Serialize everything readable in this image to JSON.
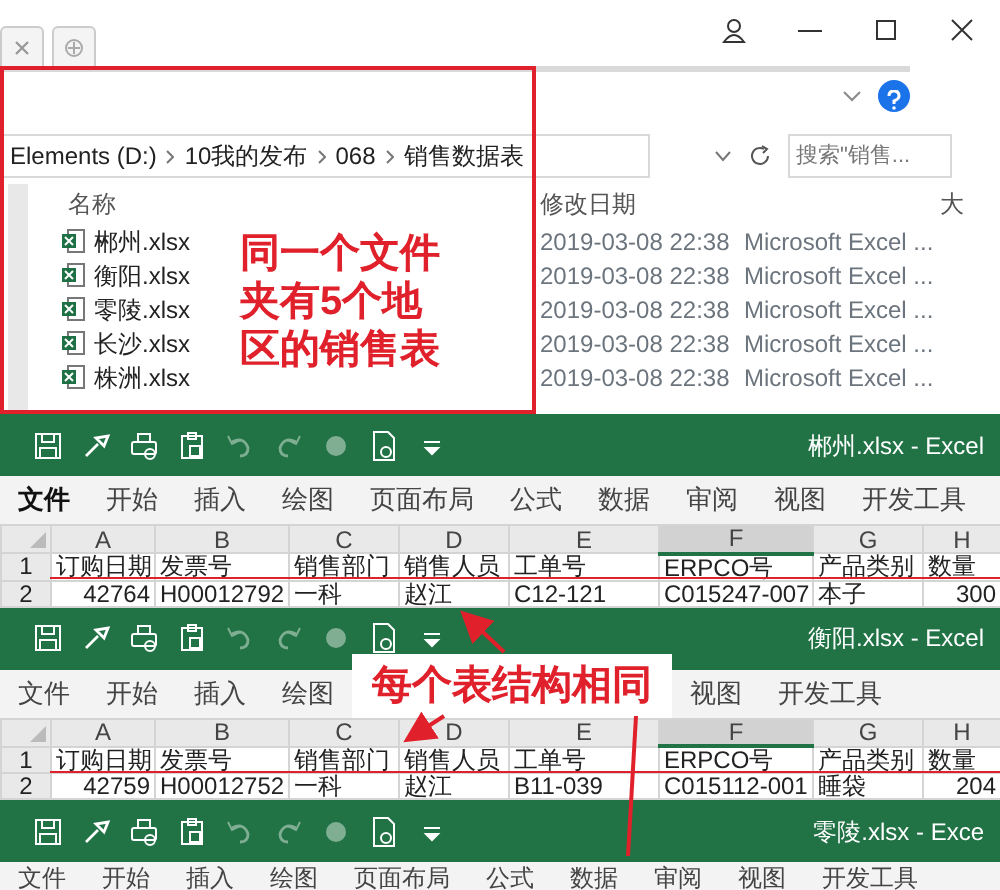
{
  "explorer": {
    "breadcrumbs": [
      "Elements (D:)",
      "10我的发布",
      "068",
      "销售数据表"
    ],
    "search": {
      "placeholder": "搜索\"销售..."
    },
    "columns": [
      "名称",
      "修改日期",
      "大"
    ],
    "files": [
      {
        "name": "郴州.xlsx",
        "modified": "2019-03-08 22:38",
        "type": "Microsoft Excel ..."
      },
      {
        "name": "衡阳.xlsx",
        "modified": "2019-03-08 22:38",
        "type": "Microsoft Excel ..."
      },
      {
        "name": "零陵.xlsx",
        "modified": "2019-03-08 22:38",
        "type": "Microsoft Excel ..."
      },
      {
        "name": "长沙.xlsx",
        "modified": "2019-03-08 22:38",
        "type": "Microsoft Excel ..."
      },
      {
        "name": "株洲.xlsx",
        "modified": "2019-03-08 22:38",
        "type": "Microsoft Excel ..."
      }
    ],
    "note": "同一个文件夹有5个地区的销售表"
  },
  "quick_access": [
    {
      "kind": "save",
      "disabled": false
    },
    {
      "kind": "brush",
      "disabled": false
    },
    {
      "kind": "print",
      "disabled": false
    },
    {
      "kind": "clipboard",
      "disabled": false
    },
    {
      "kind": "undo",
      "disabled": true
    },
    {
      "kind": "redo",
      "disabled": true
    },
    {
      "kind": "circle",
      "disabled": true
    },
    {
      "kind": "document",
      "disabled": false
    },
    {
      "kind": "more",
      "disabled": false
    }
  ],
  "workbooks": [
    {
      "title": "郴州.xlsx - Excel",
      "tabs": [
        {
          "label": "文件",
          "selected": true
        },
        {
          "label": "开始",
          "selected": false
        },
        {
          "label": "插入",
          "selected": false
        },
        {
          "label": "绘图",
          "selected": false
        },
        {
          "label": "页面布局",
          "selected": false
        },
        {
          "label": "公式",
          "selected": false
        },
        {
          "label": "数据",
          "selected": false
        },
        {
          "label": "审阅",
          "selected": false
        },
        {
          "label": "视图",
          "selected": false
        },
        {
          "label": "开发工具",
          "selected": false
        }
      ],
      "columns": [
        {
          "label": "A",
          "selected": false
        },
        {
          "label": "B",
          "selected": false
        },
        {
          "label": "C",
          "selected": false
        },
        {
          "label": "D",
          "selected": false
        },
        {
          "label": "E",
          "selected": false
        },
        {
          "label": "F",
          "selected": true
        },
        {
          "label": "G",
          "selected": false
        },
        {
          "label": "H",
          "selected": false
        }
      ],
      "rows": [
        {
          "number": "1",
          "cells": [
            "订购日期",
            "发票号",
            "销售部门",
            "销售人员",
            "工单号",
            "ERPCO号",
            "产品类别",
            "数量"
          ]
        },
        {
          "number": "2",
          "cells": [
            "42764",
            "H00012792",
            "一科",
            "赵江",
            "C12-121",
            "C015247-007",
            "本子",
            "300"
          ]
        }
      ]
    },
    {
      "title": "衡阳.xlsx - Excel",
      "callout": "每个表结构相同",
      "tabs": [
        {
          "label": "文件",
          "selected": false
        },
        {
          "label": "开始",
          "selected": false
        },
        {
          "label": "插入",
          "selected": false
        },
        {
          "label": "绘图",
          "selected": false
        },
        {
          "label": "视图",
          "selected": false
        },
        {
          "label": "开发工具",
          "selected": false
        }
      ],
      "columns": [
        {
          "label": "A",
          "selected": false
        },
        {
          "label": "B",
          "selected": false
        },
        {
          "label": "C",
          "selected": false
        },
        {
          "label": "D",
          "selected": false
        },
        {
          "label": "E",
          "selected": false
        },
        {
          "label": "F",
          "selected": true
        },
        {
          "label": "G",
          "selected": false
        },
        {
          "label": "H",
          "selected": false
        }
      ],
      "rows": [
        {
          "number": "1",
          "cells": [
            "订购日期",
            "发票号",
            "销售部门",
            "销售人员",
            "工单号",
            "ERPCO号",
            "产品类别",
            "数量"
          ]
        },
        {
          "number": "2",
          "cells": [
            "42759",
            "H00012752",
            "一科",
            "赵江",
            "B11-039",
            "C015112-001",
            "睡袋",
            "204"
          ]
        }
      ]
    },
    {
      "title": "零陵.xlsx - Exce",
      "tabs": [
        {
          "label": "文件",
          "selected": false
        },
        {
          "label": "开始",
          "selected": false
        },
        {
          "label": "插入",
          "selected": false
        },
        {
          "label": "绘图",
          "selected": false
        },
        {
          "label": "页面布局",
          "selected": false
        },
        {
          "label": "公式",
          "selected": false
        },
        {
          "label": "数据",
          "selected": false
        },
        {
          "label": "审阅",
          "selected": false
        },
        {
          "label": "视图",
          "selected": false
        },
        {
          "label": "开发工具",
          "selected": false
        }
      ]
    }
  ]
}
